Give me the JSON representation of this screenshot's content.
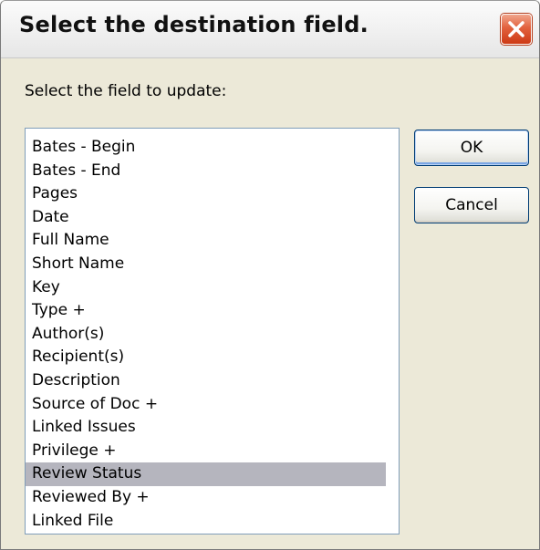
{
  "dialog": {
    "title": "Select the destination field.",
    "prompt": "Select the field to update:",
    "ok_label": "OK",
    "cancel_label": "Cancel",
    "close_icon": "close-icon",
    "close_color": "#e2613d"
  },
  "fields": [
    {
      "label": "Bates - Begin",
      "selected": false
    },
    {
      "label": "Bates - End",
      "selected": false
    },
    {
      "label": "Pages",
      "selected": false
    },
    {
      "label": "Date",
      "selected": false
    },
    {
      "label": "Full Name",
      "selected": false
    },
    {
      "label": "Short Name",
      "selected": false
    },
    {
      "label": "Key",
      "selected": false
    },
    {
      "label": "Type +",
      "selected": false
    },
    {
      "label": "Author(s)",
      "selected": false
    },
    {
      "label": "Recipient(s)",
      "selected": false
    },
    {
      "label": "Description",
      "selected": false
    },
    {
      "label": "Source of Doc +",
      "selected": false
    },
    {
      "label": "Linked Issues",
      "selected": false
    },
    {
      "label": "Privilege +",
      "selected": false
    },
    {
      "label": "Review Status",
      "selected": true
    },
    {
      "label": "Reviewed By +",
      "selected": false
    },
    {
      "label": "Linked File",
      "selected": false
    }
  ],
  "colors": {
    "selection": "#b5b5be",
    "dialog_background": "#ece9d8",
    "button_border": "#003c74"
  }
}
